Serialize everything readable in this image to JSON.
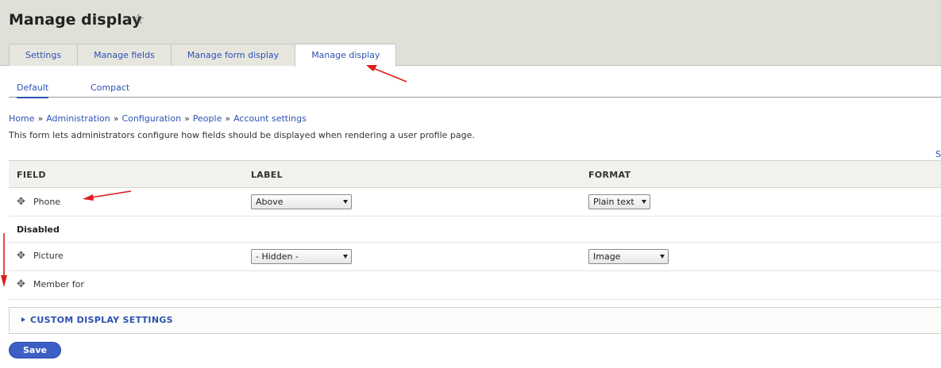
{
  "header": {
    "title": "Manage display",
    "star_icon": "star-outline-icon"
  },
  "tabs": [
    {
      "label": "Settings"
    },
    {
      "label": "Manage fields"
    },
    {
      "label": "Manage form display"
    },
    {
      "label": "Manage display",
      "active": true
    }
  ],
  "subtabs": [
    {
      "label": "Default",
      "active": true
    },
    {
      "label": "Compact"
    }
  ],
  "breadcrumb": [
    "Home",
    "Administration",
    "Configuration",
    "People",
    "Account settings"
  ],
  "breadcrumb_separator": "»",
  "description": "This form lets administrators configure how fields should be displayed when rendering a user profile page.",
  "show_weights": "S",
  "table": {
    "columns": [
      "FIELD",
      "LABEL",
      "FORMAT"
    ],
    "rows": [
      {
        "field": "Phone",
        "label": "Above",
        "format": "Plain text"
      },
      {
        "region": "Disabled"
      },
      {
        "field": "Picture",
        "label": "- Hidden -",
        "format": "Image"
      },
      {
        "field": "Member for"
      }
    ]
  },
  "details": {
    "label": "CUSTOM DISPLAY SETTINGS"
  },
  "save_button": "Save",
  "colors": {
    "link": "#2c52b3",
    "header_bg": "#e0e0d8",
    "button": "#3d5fc5",
    "annotation_arrow": "#e01b1b"
  }
}
